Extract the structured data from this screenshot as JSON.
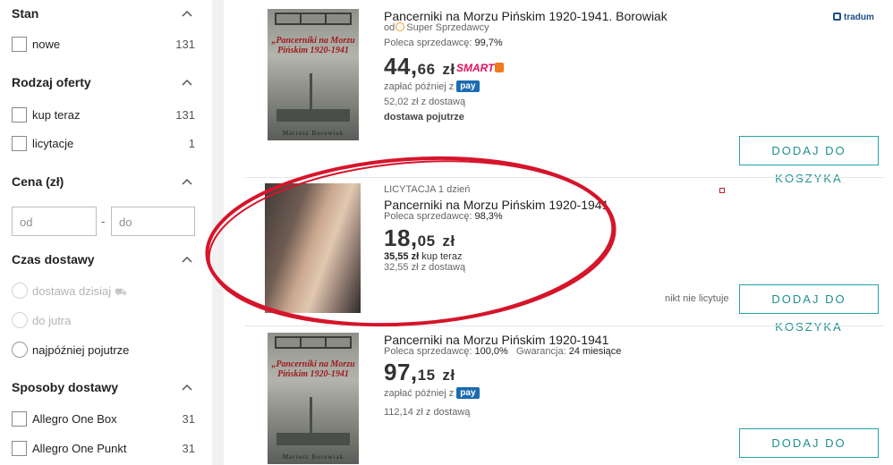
{
  "filters": {
    "stan": {
      "title": "Stan",
      "items": [
        {
          "label": "nowe",
          "count": "131"
        }
      ]
    },
    "rodzaj": {
      "title": "Rodzaj oferty",
      "items": [
        {
          "label": "kup teraz",
          "count": "131"
        },
        {
          "label": "licytacje",
          "count": "1"
        }
      ]
    },
    "cena": {
      "title": "Cena (zł)",
      "from_placeholder": "od",
      "to_placeholder": "do",
      "separator": "-"
    },
    "czas": {
      "title": "Czas dostawy",
      "items": [
        {
          "label": "dostawa dzisiaj",
          "disabled": true
        },
        {
          "label": "do jutra",
          "disabled": true
        },
        {
          "label": "najpóźniej pojutrze",
          "disabled": false
        }
      ]
    },
    "sposoby": {
      "title": "Sposoby dostawy",
      "items": [
        {
          "label": "Allegro One Box",
          "count": "31"
        },
        {
          "label": "Allegro One Punkt",
          "count": "31"
        }
      ]
    }
  },
  "listings": [
    {
      "title": "Pancerniki na Morzu Pińskim 1920-1941. Borowiak",
      "seller_prefix": "od",
      "seller_badge": "Super Sprzedawcy",
      "recommend_label": "Poleca sprzedawcę:",
      "recommend_value": "99,7%",
      "price_int": "44,",
      "price_dec": "66",
      "currency": "zł",
      "smart": "SMART",
      "pay_later": "zapłać później z",
      "pay_badge": "pay",
      "delivery_price": "52,02 zł z dostawą",
      "delivery_time": "dostawa pojutrze",
      "brand": "tradum",
      "cover_title": "„Pancerniki na Morzu Pińskim 1920-1941",
      "cover_author": "Mariusz Borowiak",
      "button": "DODAJ DO KOSZYKA"
    },
    {
      "auction_label": "LICYTACJA 1 dzień",
      "title": "Pancerniki na Morzu Pińskim 1920-1941",
      "recommend_label": "Poleca sprzedawcę:",
      "recommend_value": "98,3%",
      "price_int": "18,",
      "price_dec": "05",
      "currency": "zł",
      "buy_now_price": "35,55 zł",
      "buy_now_label": "kup teraz",
      "delivery_price": "32,55 zł z dostawą",
      "bids": "nikt nie licytuje",
      "button": "DODAJ DO KOSZYKA"
    },
    {
      "title": "Pancerniki na Morzu Pińskim 1920-1941",
      "recommend_label": "Poleca sprzedawcę:",
      "recommend_value": "100,0%",
      "warranty_label": "Gwarancja:",
      "warranty_value": "24 miesiące",
      "price_int": "97,",
      "price_dec": "15",
      "currency": "zł",
      "pay_later": "zapłać później z",
      "pay_badge": "pay",
      "delivery_price": "112,14 zł z dostawą",
      "cover_title": "„Pancerniki na Morzu Pińskim 1920-1941",
      "cover_author": "Mariusz Borowiak",
      "button": "DODAJ DO KOSZYKA"
    }
  ],
  "colors": {
    "accent": "#27a5a5",
    "annotation": "#d5152b",
    "smart": "#e1115b",
    "pay": "#1b6bb0"
  },
  "icons": {
    "chevron": "chevron-up-icon",
    "truck": "truck-icon",
    "seller": "super-seller-icon"
  }
}
